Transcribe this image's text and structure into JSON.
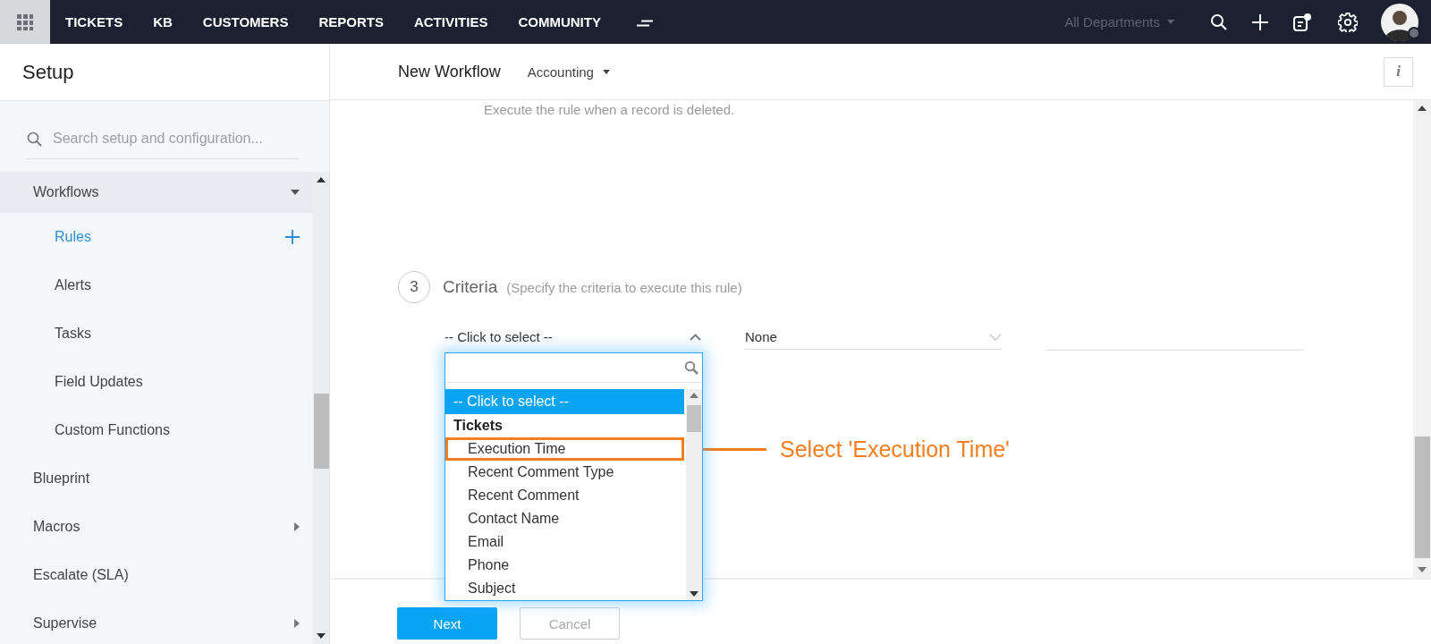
{
  "topnav": {
    "tabs": [
      {
        "label": "TICKETS",
        "selected": false
      },
      {
        "label": "KB",
        "selected": false
      },
      {
        "label": "CUSTOMERS",
        "selected": false
      },
      {
        "label": "REPORTS",
        "selected": false
      },
      {
        "label": "ACTIVITIES",
        "selected": false
      },
      {
        "label": "COMMUNITY",
        "selected": false
      }
    ],
    "department": "All Departments"
  },
  "sidebar": {
    "title": "Setup",
    "search": {
      "placeholder": "Search setup and configuration..."
    },
    "items": [
      {
        "label": "Workflows",
        "kind": "group",
        "expanded": true,
        "children": [
          {
            "label": "Rules",
            "selected": true
          },
          {
            "label": "Alerts",
            "selected": false
          },
          {
            "label": "Tasks",
            "selected": false
          },
          {
            "label": "Field Updates",
            "selected": false
          },
          {
            "label": "Custom Functions",
            "selected": false
          }
        ]
      },
      {
        "label": "Blueprint",
        "kind": "page"
      },
      {
        "label": "Macros",
        "kind": "group",
        "expanded": false
      },
      {
        "label": "Escalate (SLA)",
        "kind": "page"
      },
      {
        "label": "Supervise",
        "kind": "group",
        "expanded": false
      }
    ]
  },
  "main": {
    "header": {
      "title": "New Workflow",
      "department": "Accounting",
      "info_button": "i"
    },
    "previous_text": "Execute the rule when a record is deleted.",
    "step": {
      "number": "3",
      "title": "Criteria",
      "hint": "(Specify the criteria to execute this rule)"
    },
    "criteria": {
      "field": {
        "value": "-- Click to select --",
        "expanded": true
      },
      "operator": {
        "value": "None"
      }
    },
    "dropdown": {
      "options": [
        {
          "label": "-- Click to select --",
          "kind": "option",
          "selected": true,
          "highlighted": false
        },
        {
          "label": "Tickets",
          "kind": "group"
        },
        {
          "label": "Execution Time",
          "kind": "option",
          "selected": false,
          "highlighted": true
        },
        {
          "label": "Recent Comment Type",
          "kind": "option",
          "selected": false,
          "highlighted": false
        },
        {
          "label": "Recent Comment",
          "kind": "option",
          "selected": false,
          "highlighted": false
        },
        {
          "label": "Contact Name",
          "kind": "option",
          "selected": false,
          "highlighted": false
        },
        {
          "label": "Email",
          "kind": "option",
          "selected": false,
          "highlighted": false
        },
        {
          "label": "Phone",
          "kind": "option",
          "selected": false,
          "highlighted": false
        },
        {
          "label": "Subject",
          "kind": "option",
          "selected": false,
          "highlighted": false
        }
      ]
    },
    "annotation": "Select 'Execution Time'",
    "footer": {
      "buttons": [
        {
          "label": "Next",
          "kind": "primary"
        },
        {
          "label": "Cancel",
          "kind": "secondary"
        }
      ]
    }
  }
}
